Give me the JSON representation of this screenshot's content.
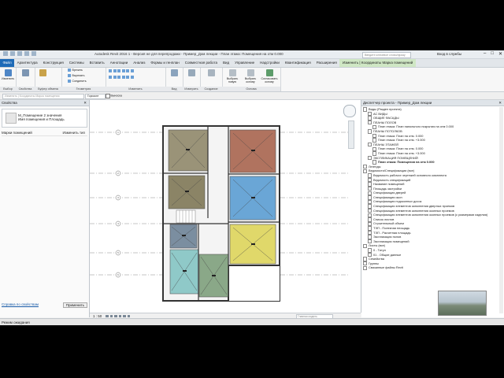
{
  "titlebar": {
    "title": "Autodesk Revit 2016 1 - Версия не для перепродажи - Пример_Дом лекции - План этажа: Помещения на отм 0.000",
    "search_placeholder": "Введите ключевое слово/фразу",
    "user": "Вход в службы"
  },
  "tabs": [
    "Файл",
    "Архитектура",
    "Конструкция",
    "Системы",
    "Вставить",
    "Аннотации",
    "Анализ",
    "Формы и генплан",
    "Совместная работа",
    "Вид",
    "Управление",
    "Надстройки",
    "Квантификация",
    "Расширения",
    "Изменить | Координаты Марка помещений"
  ],
  "ribbon": {
    "modify_label": "Изменить",
    "select_label": "Выбор",
    "properties_label": "Свойства",
    "clipboard_label": "Буфер обмена",
    "geometry_label": "Геометрия",
    "geometry_items": [
      "Врезать",
      "Вырезать",
      "Соединить"
    ],
    "modify_panel_label": "Изменить",
    "view_label": "Вид",
    "measure_label": "Измерить",
    "create_label": "Создание",
    "host_label": "Основа",
    "host_items": [
      "Выбрать новую",
      "Выбрать основу",
      "Согласовать основу"
    ]
  },
  "toolbar": {
    "command_placeholder": "Изменить | Координаты Марка помещения",
    "combo_value": "Горизонт",
    "leader_label": "Выноска"
  },
  "properties": {
    "header": "Свойства",
    "type_line1": "М_Помещение 2 значения",
    "type_line2": "Имя помещения и Площадь",
    "row1_label": "Марки помещений",
    "row1_value": "Изменить тип",
    "help_link": "Справка по свойствам",
    "apply_button": "Применить"
  },
  "status": "Режим ожидания",
  "view": {
    "scale": "1 : 50",
    "filter_placeholder": "Главная модель",
    "grid_labels": [
      "1",
      "2",
      "3",
      "4",
      "5",
      "6",
      "7"
    ],
    "room_colors": [
      "#9a9378",
      "#b0735f",
      "#8b8466",
      "#6aa6d6",
      "#7b8ea0",
      "#e0d86a",
      "#8fc9c8",
      "#8aa888"
    ]
  },
  "browser": {
    "header": "Диспетчер проекта - Пример_Дом лекции",
    "nodes": [
      {
        "label": "Виды (Раздел проекта)",
        "bold": false
      },
      {
        "label": "АС ВИДЫ",
        "bold": false
      },
      {
        "label": "ОБЩИЕ ФАСАДЫ",
        "bold": false
      },
      {
        "label": "ПЛАНЫ ПОЛОВ",
        "bold": false
      },
      {
        "label": "План этажа: План напольного покрытия на отм 0.000",
        "bold": false
      },
      {
        "label": "ПЛАНЫ ПОТОЛКОВ",
        "bold": false
      },
      {
        "label": "План этажа: План на отм. 0.000",
        "bold": false
      },
      {
        "label": "План этажа: План на отм. +3.000",
        "bold": false
      },
      {
        "label": "ПЛАНЫ ЭТАЖЕЙ",
        "bold": false
      },
      {
        "label": "План этажа: План на отм. 0.000",
        "bold": false
      },
      {
        "label": "План этажа: План на отм. +3.000",
        "bold": false
      },
      {
        "label": "ЭКСПЛИКАЦИЯ ПОМЕЩЕНИЙ",
        "bold": false
      },
      {
        "label": "План этажа: Помещения на отм 0.000",
        "bold": true
      },
      {
        "label": "Легенды",
        "bold": false
      },
      {
        "label": "Ведомости/Спецификации (все)",
        "bold": false
      },
      {
        "label": "Ведомость рабочих чертежей основного комплекта",
        "bold": false
      },
      {
        "label": "Ведомость спецификаций",
        "bold": false
      },
      {
        "label": "Название помещений",
        "bold": false
      },
      {
        "label": "Площадь застройки",
        "bold": false
      },
      {
        "label": "Спецификация дверей",
        "bold": false
      },
      {
        "label": "Спецификация окон",
        "bold": false
      },
      {
        "label": "Спецификация подоконных досок",
        "bold": false
      },
      {
        "label": "Спецификация элементов заполнения дверных проемов",
        "bold": false
      },
      {
        "label": "Спецификация элементов заполнения оконных проемов",
        "bold": false
      },
      {
        "label": "Спецификация элементов заполнения оконных проемов (с размерами изделия)",
        "bold": false
      },
      {
        "label": "Список листов",
        "bold": false
      },
      {
        "label": "Строительный объем",
        "bold": false
      },
      {
        "label": "ТЭП - Полезная площадь",
        "bold": false
      },
      {
        "label": "ТЭП - Расчетная площадь",
        "bold": false
      },
      {
        "label": "Экспликация полов",
        "bold": false
      },
      {
        "label": "Экспликация помещений",
        "bold": false
      },
      {
        "label": "Листы (все)",
        "bold": false
      },
      {
        "label": "0 - Титул",
        "bold": false
      },
      {
        "label": "01 - Общие данные",
        "bold": false
      },
      {
        "label": "Семейства",
        "bold": false
      },
      {
        "label": "Группы",
        "bold": false
      },
      {
        "label": "Связанные файлы Revit",
        "bold": false
      }
    ]
  }
}
